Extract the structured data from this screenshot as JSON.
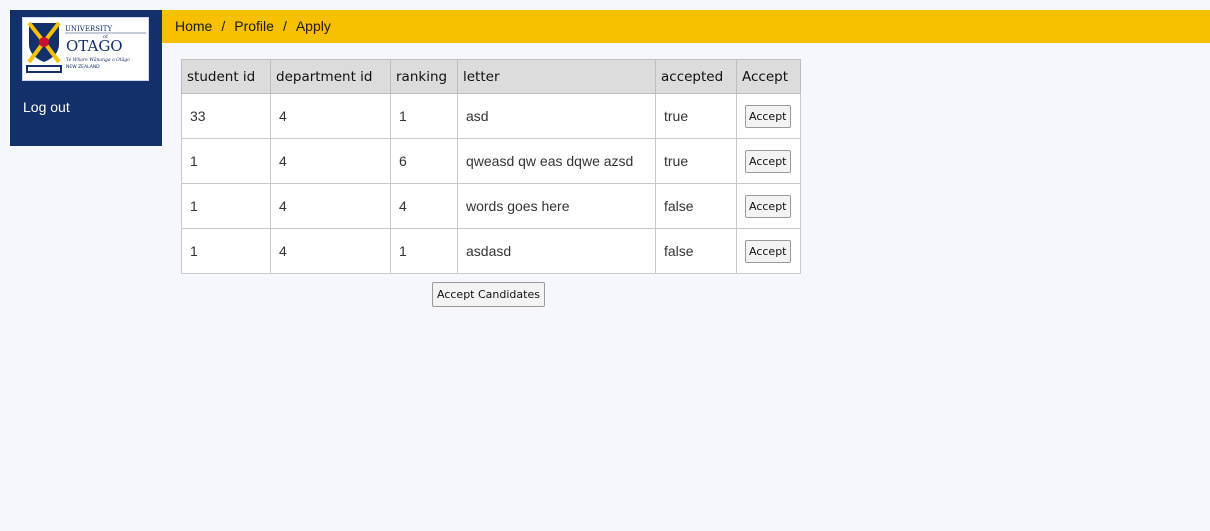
{
  "breadcrumb": {
    "home": "Home",
    "profile": "Profile",
    "apply": "Apply",
    "separator": "/"
  },
  "sidebar": {
    "logout": "Log out",
    "logo": {
      "line1": "UNIVERSITY",
      "line2": "of",
      "line3": "OTAGO",
      "line4": "Te Whare Wānanga o Otāgo",
      "line5": "NEW ZEALAND"
    }
  },
  "table": {
    "headers": [
      "student id",
      "department id",
      "ranking",
      "letter",
      "accepted",
      "Accept"
    ],
    "rows": [
      {
        "student_id": "33",
        "department_id": "4",
        "ranking": "1",
        "letter": "asd",
        "accepted": "true",
        "button": "Accept"
      },
      {
        "student_id": "1",
        "department_id": "4",
        "ranking": "6",
        "letter": "qweasd qw eas dqwe azsd",
        "accepted": "true",
        "button": "Accept"
      },
      {
        "student_id": "1",
        "department_id": "4",
        "ranking": "4",
        "letter": "words goes here",
        "accepted": "false",
        "button": "Accept"
      },
      {
        "student_id": "1",
        "department_id": "4",
        "ranking": "1",
        "letter": "asdasd",
        "accepted": "false",
        "button": "Accept"
      }
    ]
  },
  "accept_candidates_label": "Accept Candidates",
  "colors": {
    "topbar": "#f8c100",
    "sidebar": "#13306a",
    "background": "#f6f7fc"
  }
}
